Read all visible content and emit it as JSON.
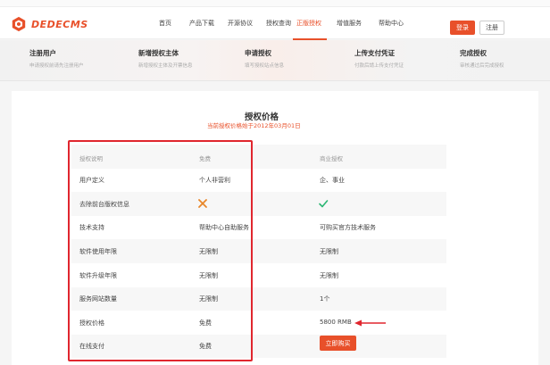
{
  "site": {
    "logo": "DEDECMS",
    "nav": [
      "首页",
      "产品下载",
      "开源协议",
      "授权查询",
      "正版授权",
      "增值服务",
      "帮助中心"
    ],
    "active_nav": "正版授权",
    "login": "登录",
    "register": "注册"
  },
  "steps": [
    {
      "title": "注册用户",
      "desc": "申请授权前请先注册用户"
    },
    {
      "title": "新增授权主体",
      "desc": "新增授权主体及开票信息"
    },
    {
      "title": "申请授权",
      "desc": "填写授权站点信息"
    },
    {
      "title": "上传支付凭证",
      "desc": "付款后請上传支付凭证"
    },
    {
      "title": "完成授权",
      "desc": "审核通过后完成授权"
    }
  ],
  "pricing": {
    "title": "授权价格",
    "date_note": "当前授权价格始于2012年03月01日",
    "columns": [
      "授权说明",
      "免费",
      "商业授权"
    ],
    "rows": [
      {
        "label": "用户定义",
        "free": "个人非营利",
        "commercial": "企、事业"
      },
      {
        "label": "去除前台版权信息",
        "free": "",
        "commercial": ""
      },
      {
        "label": "技术支持",
        "free": "帮助中心自助服务",
        "commercial": "可购买官方技术服务"
      },
      {
        "label": "软件使用年限",
        "free": "无限制",
        "commercial": "无限制"
      },
      {
        "label": "软件升级年限",
        "free": "无限制",
        "commercial": "无限制"
      },
      {
        "label": "服务网站数量",
        "free": "无限制",
        "commercial": "1个"
      },
      {
        "label": "授权价格",
        "free": "免费",
        "commercial": "5800 RMB"
      },
      {
        "label": "在线支付",
        "free": "免费",
        "commercial": ""
      }
    ],
    "buy_button": "立即购买"
  },
  "colors": {
    "accent": "#e8502a",
    "highlight_box": "#e0262e",
    "check": "#2bb673"
  },
  "icons": {
    "free_row_2": "cross-icon",
    "commercial_row_2": "check-icon",
    "price_pointer": "arrow-left-icon"
  }
}
